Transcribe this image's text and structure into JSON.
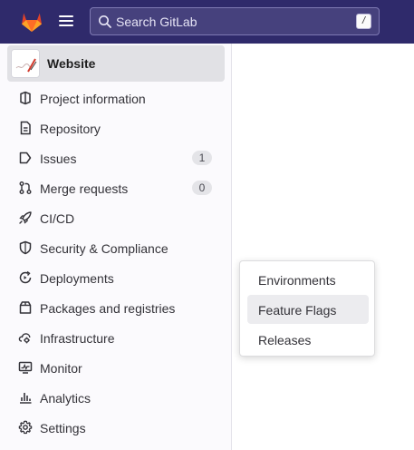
{
  "topbar": {
    "search_placeholder": "Search GitLab",
    "search_shortcut": "/"
  },
  "project": {
    "name": "Website"
  },
  "nav": {
    "items": [
      {
        "label": "Project information",
        "icon": "project-info-icon"
      },
      {
        "label": "Repository",
        "icon": "repository-icon"
      },
      {
        "label": "Issues",
        "icon": "issues-icon",
        "count": "1"
      },
      {
        "label": "Merge requests",
        "icon": "merge-request-icon",
        "count": "0"
      },
      {
        "label": "CI/CD",
        "icon": "rocket-icon"
      },
      {
        "label": "Security & Compliance",
        "icon": "shield-icon"
      },
      {
        "label": "Deployments",
        "icon": "deployments-icon"
      },
      {
        "label": "Packages and registries",
        "icon": "package-icon"
      },
      {
        "label": "Infrastructure",
        "icon": "cloud-gear-icon"
      },
      {
        "label": "Monitor",
        "icon": "monitor-icon"
      },
      {
        "label": "Analytics",
        "icon": "chart-icon"
      },
      {
        "label": "Settings",
        "icon": "gear-icon"
      }
    ]
  },
  "flyout": {
    "items": [
      {
        "label": "Environments"
      },
      {
        "label": "Feature Flags",
        "active": true
      },
      {
        "label": "Releases"
      }
    ]
  },
  "colors": {
    "topbar_bg": "#2f2a6b",
    "gitlab_orange": "#e24329",
    "sidebar_bg": "#fbfafd",
    "active_bg": "#e1e1e5"
  }
}
